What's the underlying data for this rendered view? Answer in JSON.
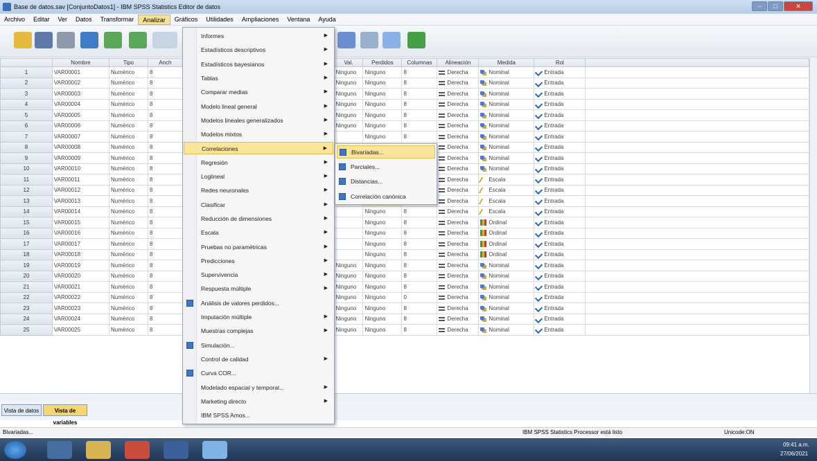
{
  "window": {
    "title": "Base de datos.sav [ConjuntoDatos1] - IBM SPSS Statistics Editor de datos"
  },
  "menubar": [
    "Archivo",
    "Editar",
    "Ver",
    "Datos",
    "Transformar",
    "Analizar",
    "Gráficos",
    "Utilidades",
    "Ampliaciones",
    "Ventana",
    "Ayuda"
  ],
  "columns": [
    "Nombre",
    "Tipo",
    "Anch",
    "",
    "Val.",
    "Perdidos",
    "Columnas",
    "Alineación",
    "Medida",
    "Rol"
  ],
  "rows": [
    {
      "n": "1",
      "name": "VAR00001",
      "tipo": "Numérico",
      "anch": "8",
      "val": "Ninguno",
      "perd": "Ninguno",
      "cols": "8",
      "alin": "Derecha",
      "medida": "Nominal",
      "mic": "nominal",
      "rol": "Entrada"
    },
    {
      "n": "2",
      "name": "VAR00002",
      "tipo": "Numérico",
      "anch": "8",
      "val": "Ninguno",
      "perd": "Ninguno",
      "cols": "8",
      "alin": "Derecha",
      "medida": "Nominal",
      "mic": "nominal",
      "rol": "Entrada"
    },
    {
      "n": "3",
      "name": "VAR00003",
      "tipo": "Numérico",
      "anch": "8",
      "val": "Ninguno",
      "perd": "Ninguno",
      "cols": "8",
      "alin": "Derecha",
      "medida": "Nominal",
      "mic": "nominal",
      "rol": "Entrada"
    },
    {
      "n": "4",
      "name": "VAR00004",
      "tipo": "Numérico",
      "anch": "8",
      "val": "Ninguno",
      "perd": "Ninguno",
      "cols": "8",
      "alin": "Derecha",
      "medida": "Nominal",
      "mic": "nominal",
      "rol": "Entrada"
    },
    {
      "n": "5",
      "name": "VAR00005",
      "tipo": "Numérico",
      "anch": "8",
      "val": "Ninguno",
      "perd": "Ninguno",
      "cols": "8",
      "alin": "Derecha",
      "medida": "Nominal",
      "mic": "nominal",
      "rol": "Entrada"
    },
    {
      "n": "6",
      "name": "VAR00006",
      "tipo": "Numérico",
      "anch": "8",
      "val": "Ninguno",
      "perd": "Ninguno",
      "cols": "8",
      "alin": "Derecha",
      "medida": "Nominal",
      "mic": "nominal",
      "rol": "Entrada"
    },
    {
      "n": "7",
      "name": "VAR00007",
      "tipo": "Numérico",
      "anch": "8",
      "val": "",
      "perd": "Ninguno",
      "cols": "8",
      "alin": "Derecha",
      "medida": "Nominal",
      "mic": "nominal",
      "rol": "Entrada"
    },
    {
      "n": "8",
      "name": "VAR00008",
      "tipo": "Numérico",
      "anch": "8",
      "val": "",
      "perd": "",
      "cols": "",
      "alin": "Derecha",
      "medida": "Nominal",
      "mic": "nominal",
      "rol": "Entrada"
    },
    {
      "n": "9",
      "name": "VAR00009",
      "tipo": "Numérico",
      "anch": "8",
      "val": "",
      "perd": "",
      "cols": "",
      "alin": "Derecha",
      "medida": "Nominal",
      "mic": "nominal",
      "rol": "Entrada"
    },
    {
      "n": "10",
      "name": "VAR00010",
      "tipo": "Numérico",
      "anch": "8",
      "val": "",
      "perd": "",
      "cols": "",
      "alin": "Derecha",
      "medida": "Nominal",
      "mic": "nominal",
      "rol": "Entrada"
    },
    {
      "n": "11",
      "name": "VAR00011",
      "tipo": "Numérico",
      "anch": "8",
      "val": "",
      "perd": "Ninguno",
      "cols": "8",
      "alin": "Derecha",
      "medida": "Escala",
      "mic": "escala",
      "rol": "Entrada"
    },
    {
      "n": "12",
      "name": "VAR00012",
      "tipo": "Numérico",
      "anch": "8",
      "val": "",
      "perd": "Ninguno",
      "cols": "8",
      "alin": "Derecha",
      "medida": "Escala",
      "mic": "escala",
      "rol": "Entrada"
    },
    {
      "n": "13",
      "name": "VAR00013",
      "tipo": "Numérico",
      "anch": "8",
      "val": "",
      "perd": "Ninguno",
      "cols": "0",
      "alin": "Derecha",
      "medida": "Escala",
      "mic": "escala",
      "rol": "Entrada"
    },
    {
      "n": "14",
      "name": "VAR00014",
      "tipo": "Numérico",
      "anch": "8",
      "val": "",
      "perd": "Ninguno",
      "cols": "8",
      "alin": "Derecha",
      "medida": "Escala",
      "mic": "escala",
      "rol": "Entrada"
    },
    {
      "n": "15",
      "name": "VAR00015",
      "tipo": "Numérico",
      "anch": "8",
      "val": "",
      "perd": "Ninguno",
      "cols": "8",
      "alin": "Derecha",
      "medida": "Ordinal",
      "mic": "ordinal",
      "rol": "Entrada"
    },
    {
      "n": "16",
      "name": "VAR00016",
      "tipo": "Numérico",
      "anch": "8",
      "val": "",
      "perd": "Ninguno",
      "cols": "8",
      "alin": "Derecha",
      "medida": "Ordinal",
      "mic": "ordinal",
      "rol": "Entrada"
    },
    {
      "n": "17",
      "name": "VAR00017",
      "tipo": "Numérico",
      "anch": "8",
      "val": "",
      "perd": "Ninguno",
      "cols": "8",
      "alin": "Derecha",
      "medida": "Ordinal",
      "mic": "ordinal",
      "rol": "Entrada"
    },
    {
      "n": "18",
      "name": "VAR00018",
      "tipo": "Numérico",
      "anch": "8",
      "val": "",
      "perd": "Ninguno",
      "cols": "8",
      "alin": "Derecha",
      "medida": "Ordinal",
      "mic": "ordinal",
      "rol": "Entrada"
    },
    {
      "n": "19",
      "name": "VAR00019",
      "tipo": "Numérico",
      "anch": "8",
      "val": "Ninguno",
      "perd": "Ninguno",
      "cols": "8",
      "alin": "Derecha",
      "medida": "Nominal",
      "mic": "nominal",
      "rol": "Entrada"
    },
    {
      "n": "20",
      "name": "VAR00020",
      "tipo": "Numérico",
      "anch": "8",
      "val": "Ninguno",
      "perd": "Ninguno",
      "cols": "8",
      "alin": "Derecha",
      "medida": "Nominal",
      "mic": "nominal",
      "rol": "Entrada"
    },
    {
      "n": "21",
      "name": "VAR00021",
      "tipo": "Numérico",
      "anch": "8",
      "val": "Ninguno",
      "perd": "Ninguno",
      "cols": "8",
      "alin": "Derecha",
      "medida": "Nominal",
      "mic": "nominal",
      "rol": "Entrada"
    },
    {
      "n": "22",
      "name": "VAR00022",
      "tipo": "Numérico",
      "anch": "8",
      "val": "Ninguno",
      "perd": "Ninguno",
      "cols": "0",
      "alin": "Derecha",
      "medida": "Nominal",
      "mic": "nominal",
      "rol": "Entrada"
    },
    {
      "n": "23",
      "name": "VAR00023",
      "tipo": "Numérico",
      "anch": "8",
      "val": "Ninguno",
      "perd": "Ninguno",
      "cols": "8",
      "alin": "Derecha",
      "medida": "Nominal",
      "mic": "nominal",
      "rol": "Entrada"
    },
    {
      "n": "24",
      "name": "VAR00024",
      "tipo": "Numérico",
      "anch": "8",
      "val": "Ninguno",
      "perd": "Ninguno",
      "cols": "8",
      "alin": "Derecha",
      "medida": "Nominal",
      "mic": "nominal",
      "rol": "Entrada"
    },
    {
      "n": "25",
      "name": "VAR00025",
      "tipo": "Numérico",
      "anch": "8",
      "val": "Ninguno",
      "perd": "Ninguno",
      "cols": "8",
      "alin": "Derecha",
      "medida": "Nominal",
      "mic": "nominal",
      "rol": "Entrada"
    }
  ],
  "analyze_menu": [
    {
      "label": "Informes",
      "arrow": true
    },
    {
      "label": "Estadísticos descriptivos",
      "arrow": true
    },
    {
      "label": "Estadísticos bayesianos",
      "arrow": true
    },
    {
      "label": "Tablas",
      "arrow": true
    },
    {
      "label": "Comparar medias",
      "arrow": true
    },
    {
      "label": "Modelo lineal general",
      "arrow": true
    },
    {
      "label": "Modelos lineales generalizados",
      "arrow": true
    },
    {
      "label": "Modelos mixtos",
      "arrow": true
    },
    {
      "label": "Correlaciones",
      "arrow": true,
      "highlight": true
    },
    {
      "label": "Regresión",
      "arrow": true
    },
    {
      "label": "Loglineal",
      "arrow": true
    },
    {
      "label": "Redes neuronales",
      "arrow": true
    },
    {
      "label": "Clasificar",
      "arrow": true
    },
    {
      "label": "Reducción de dimensiones",
      "arrow": true
    },
    {
      "label": "Escala",
      "arrow": true
    },
    {
      "label": "Pruebas no paramétricas",
      "arrow": true
    },
    {
      "label": "Predicciones",
      "arrow": true
    },
    {
      "label": "Supervivencia",
      "arrow": true
    },
    {
      "label": "Respuesta múltiple",
      "arrow": true
    },
    {
      "label": "Análisis de valores perdidos...",
      "arrow": false,
      "icon": true
    },
    {
      "label": "Imputación múltiple",
      "arrow": true
    },
    {
      "label": "Muestras complejas",
      "arrow": true
    },
    {
      "label": "Simulación...",
      "arrow": false,
      "icon": true
    },
    {
      "label": "Control de calidad",
      "arrow": true
    },
    {
      "label": "Curva COR...",
      "arrow": false,
      "icon": true
    },
    {
      "label": "Modelado espacial y temporal...",
      "arrow": true
    },
    {
      "label": "Marketing directo",
      "arrow": true
    },
    {
      "label": "IBM SPSS Amos..."
    }
  ],
  "correlaciones_submenu": [
    "Bivariadas...",
    "Parciales...",
    "Distancias...",
    "Correlación canónica"
  ],
  "tabs": {
    "data_view": "Vista de datos",
    "variable_view": "Vista de variables"
  },
  "status": {
    "left": "Bivariadas...",
    "processor": "IBM SPSS Statistics Processor está listo",
    "unicode": "Unicode:ON"
  },
  "taskbar": {
    "time": "09:41 a.m.",
    "date": "27/06/2021"
  }
}
